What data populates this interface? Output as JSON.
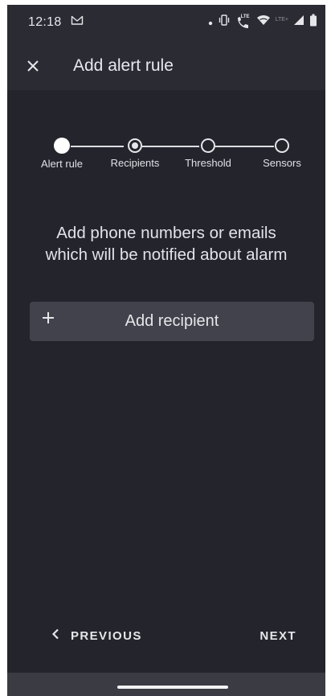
{
  "status_bar": {
    "time": "12:18",
    "icons": [
      "gmail-icon",
      "dot-icon",
      "vibrate-icon",
      "volte-call-icon",
      "wifi-icon",
      "lte-signal-icon",
      "cell-signal-icon",
      "battery-icon"
    ],
    "lte_label": "LTE",
    "lte_plus_label": "LTE+"
  },
  "app_bar": {
    "title": "Add alert rule",
    "close_icon": "close-icon"
  },
  "stepper": {
    "steps": [
      {
        "label": "Alert rule",
        "state": "completed"
      },
      {
        "label": "Recipients",
        "state": "current"
      },
      {
        "label": "Threshold",
        "state": "upcoming"
      },
      {
        "label": "Sensors",
        "state": "upcoming"
      }
    ]
  },
  "content": {
    "description_line1": "Add phone numbers or emails",
    "description_line2": "which will be notified about alarm",
    "add_recipient_label": "Add recipient",
    "add_icon": "plus-icon"
  },
  "navigation": {
    "previous_label": "PREVIOUS",
    "next_label": "NEXT",
    "previous_icon": "chevron-left-icon"
  },
  "colors": {
    "background": "#24242c",
    "app_bar": "#2a2b33",
    "button": "#41424b",
    "text": "#e6e6ea"
  }
}
